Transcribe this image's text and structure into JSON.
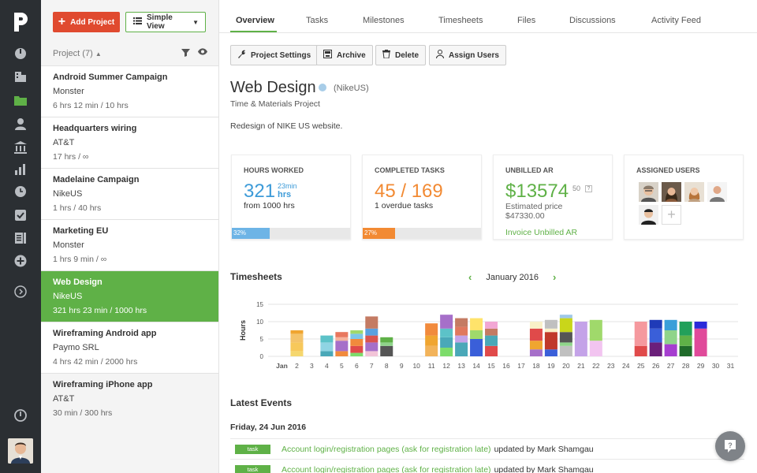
{
  "app": {
    "logo_text": "P"
  },
  "rail": {
    "icons": [
      "dashboard-icon",
      "clients-icon",
      "projects-icon",
      "user-icon",
      "bank-icon",
      "reports-icon",
      "clock-icon",
      "checkbox-icon",
      "invoice-icon",
      "add-icon",
      "expand-icon",
      "power-icon"
    ]
  },
  "toolbar": {
    "add_project_label": "Add Project",
    "view_label": "Simple View"
  },
  "project_list": {
    "header": "Project (7)",
    "projects": [
      {
        "name": "Android Summer Campaign",
        "client": "Monster",
        "hours": "6 hrs 12 min / 10 hrs"
      },
      {
        "name": "Headquarters wiring",
        "client": "AT&T",
        "hours": "17 hrs / ∞"
      },
      {
        "name": "Madelaine Campaign",
        "client": "NikeUS",
        "hours": "1 hrs / 40 hrs"
      },
      {
        "name": "Marketing EU",
        "client": "Monster",
        "hours": "1 hrs 9 min / ∞"
      },
      {
        "name": "Web Design",
        "client": "NikeUS",
        "hours": "321 hrs 23 min / 1000 hrs"
      },
      {
        "name": "Wireframing Android app",
        "client": "Paymo SRL",
        "hours": "4 hrs 42 min / 2000 hrs"
      },
      {
        "name": "Wireframing iPhone app",
        "client": "AT&T",
        "hours": "30 min / 300 hrs"
      }
    ],
    "active_index": 4
  },
  "tabs": [
    "Overview",
    "Tasks",
    "Milestones",
    "Timesheets",
    "Files",
    "Discussions",
    "Activity Feed"
  ],
  "actions": {
    "settings": "Project Settings",
    "archive": "Archive",
    "delete": "Delete",
    "assign": "Assign Users"
  },
  "project": {
    "title": "Web Design",
    "client": "(NikeUS)",
    "type": "Time & Materials Project",
    "description": "Redesign of NIKE US website.",
    "status_color": "#a8cde8"
  },
  "stats": {
    "hours": {
      "label": "HOURS WORKED",
      "value": "321",
      "min": "23min",
      "unit": "hrs",
      "sub": "from 1000 hrs",
      "progress_label": "32%",
      "progress": 0.32
    },
    "tasks": {
      "label": "COMPLETED TASKS",
      "value": "45 / 169",
      "sub": "1 overdue tasks",
      "progress_label": "27%",
      "progress": 0.27
    },
    "unbilled": {
      "label": "UNBILLED AR",
      "value": "$13574",
      "cents": "50",
      "help": "?",
      "est_label": "Estimated price",
      "est_value": "$47330.00",
      "link": "Invoice Unbilled AR"
    },
    "users": {
      "label": "ASSIGNED USERS",
      "add": "+"
    }
  },
  "timesheets": {
    "title": "Timesheets",
    "period": "January 2016",
    "prev": "‹",
    "next": "›"
  },
  "chart_data": {
    "type": "bar",
    "ylabel": "Hours",
    "ylim": [
      0,
      15
    ],
    "yticks": [
      0,
      5,
      10,
      15
    ],
    "grid": true,
    "month_label": "Jan",
    "categories": [
      "1",
      "2",
      "3",
      "4",
      "5",
      "6",
      "7",
      "8",
      "9",
      "10",
      "11",
      "12",
      "13",
      "14",
      "15",
      "16",
      "17",
      "18",
      "19",
      "20",
      "21",
      "22",
      "23",
      "24",
      "25",
      "26",
      "27",
      "28",
      "29",
      "30",
      "31"
    ],
    "stacks": [
      [],
      [
        {
          "v": 1.5,
          "c": "#f5d76e"
        },
        {
          "v": 2.5,
          "c": "#f7c85b"
        },
        {
          "v": 2.5,
          "c": "#f4c36a"
        },
        {
          "v": 1,
          "c": "#f0a530"
        }
      ],
      [],
      [
        {
          "v": 1.5,
          "c": "#4aa8b8"
        },
        {
          "v": 2.5,
          "c": "#8fd4e3"
        },
        {
          "v": 2,
          "c": "#5cc2c8"
        }
      ],
      [
        {
          "v": 1.5,
          "c": "#f18a3c"
        },
        {
          "v": 3,
          "c": "#a66fc9"
        },
        {
          "v": 1,
          "c": "#f5b29c"
        },
        {
          "v": 1.5,
          "c": "#e8775e"
        }
      ],
      [
        {
          "v": 1,
          "c": "#7ddc6b"
        },
        {
          "v": 2,
          "c": "#e04a4a"
        },
        {
          "v": 2,
          "c": "#f18a3c"
        },
        {
          "v": 1.5,
          "c": "#7ec6e8"
        },
        {
          "v": 1,
          "c": "#a0d96b"
        }
      ],
      [
        {
          "v": 1.5,
          "c": "#f2c4d8"
        },
        {
          "v": 2.5,
          "c": "#a66fc9"
        },
        {
          "v": 2,
          "c": "#d9534f"
        },
        {
          "v": 2,
          "c": "#5aa0e0"
        },
        {
          "v": 3.5,
          "c": "#c47b63"
        }
      ],
      [
        {
          "v": 3,
          "c": "#555"
        },
        {
          "v": 1,
          "c": "#8fd48a"
        },
        {
          "v": 1.5,
          "c": "#5fb147"
        }
      ],
      [],
      [],
      [
        {
          "v": 3,
          "c": "#f2b35a"
        },
        {
          "v": 3,
          "c": "#f0a530"
        },
        {
          "v": 3.5,
          "c": "#f18a3c"
        }
      ],
      [
        {
          "v": 2.5,
          "c": "#7ddc6b"
        },
        {
          "v": 3,
          "c": "#4aa8b8"
        },
        {
          "v": 2.5,
          "c": "#5cc2c8"
        },
        {
          "v": 4,
          "c": "#a66fc9"
        }
      ],
      [
        {
          "v": 4,
          "c": "#4aa8b8"
        },
        {
          "v": 2,
          "c": "#c4a3e8"
        },
        {
          "v": 2.5,
          "c": "#e0785e"
        },
        {
          "v": 2.5,
          "c": "#c47b63"
        }
      ],
      [
        {
          "v": 5,
          "c": "#3a5fd9"
        },
        {
          "v": 2.5,
          "c": "#a0d96b"
        },
        {
          "v": 3.5,
          "c": "#ffe36b"
        }
      ],
      [
        {
          "v": 3,
          "c": "#e04a4a"
        },
        {
          "v": 3,
          "c": "#4aa8b8"
        },
        {
          "v": 2,
          "c": "#c47b63"
        },
        {
          "v": 2,
          "c": "#f2a6d4"
        }
      ],
      [],
      [],
      [
        {
          "v": 2,
          "c": "#a66fc9"
        },
        {
          "v": 2.5,
          "c": "#f0a530"
        },
        {
          "v": 3.5,
          "c": "#e04a4a"
        },
        {
          "v": 2,
          "c": "#f9f0c8"
        }
      ],
      [
        {
          "v": 2,
          "c": "#3a5fd9"
        },
        {
          "v": 5,
          "c": "#c0392b"
        },
        {
          "v": 1,
          "c": "#f9f0c8"
        },
        {
          "v": 2.5,
          "c": "#c0c0c0"
        }
      ],
      [
        {
          "v": 3,
          "c": "#c0c0c0"
        },
        {
          "v": 1,
          "c": "#8fd48a"
        },
        {
          "v": 3,
          "c": "#555"
        },
        {
          "v": 4,
          "c": "#c9d61a"
        },
        {
          "v": 1,
          "c": "#a0c8e8"
        }
      ],
      [
        {
          "v": 10,
          "c": "#c4a3e8"
        }
      ],
      [
        {
          "v": 4.5,
          "c": "#f2c4f0"
        },
        {
          "v": 6,
          "c": "#a0d96b"
        }
      ],
      [],
      [],
      [
        {
          "v": 3,
          "c": "#e04a4a"
        },
        {
          "v": 7,
          "c": "#f5999e"
        }
      ],
      [
        {
          "v": 4,
          "c": "#6b1f7a"
        },
        {
          "v": 4,
          "c": "#3a5fd9"
        },
        {
          "v": 2.5,
          "c": "#1f3bb8"
        }
      ],
      [
        {
          "v": 3.5,
          "c": "#a63ed0"
        },
        {
          "v": 4,
          "c": "#8fd48a"
        },
        {
          "v": 3,
          "c": "#3a9fd9"
        }
      ],
      [
        {
          "v": 3,
          "c": "#1f6b2a"
        },
        {
          "v": 3,
          "c": "#5fb147"
        },
        {
          "v": 4,
          "c": "#22a05a"
        }
      ],
      [
        {
          "v": 8,
          "c": "#e04a9a"
        },
        {
          "v": 2,
          "c": "#2a2ad9"
        }
      ],
      [],
      []
    ]
  },
  "events": {
    "title": "Latest Events",
    "date": "Friday, 24 Jun 2016",
    "items": [
      {
        "tag": "task",
        "link": "Account login/registration pages (ask for registration late)",
        "rest": "updated by Mark Shamgau"
      },
      {
        "tag": "task",
        "link": "Account login/registration pages (ask for registration late)",
        "rest": "updated by Mark Shamgau"
      }
    ]
  },
  "help": {
    "label": "?"
  }
}
